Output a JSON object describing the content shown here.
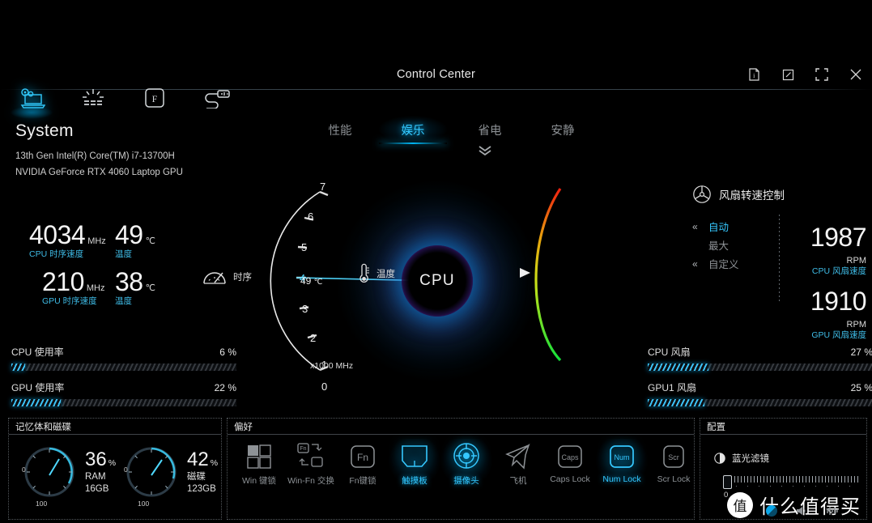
{
  "window": {
    "title": "Control Center",
    "buttons": [
      {
        "name": "info-button",
        "icon": "info-icon"
      },
      {
        "name": "shrink-button",
        "icon": "shrink-icon"
      },
      {
        "name": "maximize-button",
        "icon": "maximize-icon"
      },
      {
        "name": "close-button",
        "icon": "close-icon"
      }
    ]
  },
  "topnav": {
    "items": [
      {
        "label": "system",
        "icon": "system-gears-laptop-icon",
        "active": true
      },
      {
        "label": "lighting",
        "icon": "keyboard-backlight-icon",
        "active": false
      },
      {
        "label": "fn-key",
        "icon": "f-key-icon",
        "active": false
      },
      {
        "label": "devices",
        "icon": "usb-device-icon",
        "active": false
      }
    ]
  },
  "system": {
    "heading": "System",
    "cpu_name": "13th Gen Intel(R) Core(TM) i7-13700H",
    "gpu_name": "NVIDIA GeForce RTX 4060 Laptop GPU"
  },
  "tabs": [
    {
      "label": "性能",
      "active": false
    },
    {
      "label": "娱乐",
      "active": true
    },
    {
      "label": "省电",
      "active": false
    },
    {
      "label": "安静",
      "active": false
    }
  ],
  "readouts": {
    "cpu_clock": {
      "value": "4034",
      "unit": "MHz",
      "label": "CPU 时序速度"
    },
    "cpu_temp": {
      "value": "49",
      "unit": "℃",
      "label": "温度"
    },
    "gpu_clock": {
      "value": "210",
      "unit": "MHz",
      "label": "GPU 时序速度"
    },
    "gpu_temp": {
      "value": "38",
      "unit": "℃",
      "label": "温度"
    },
    "timing_label": "时序"
  },
  "usage": {
    "cpu": {
      "label": "CPU 使用率",
      "value": "6",
      "unit": "%",
      "percent": 6
    },
    "gpu": {
      "label": "GPU 使用率",
      "value": "22",
      "unit": "%",
      "percent": 22
    },
    "cpu_fan": {
      "label": "CPU 风扇",
      "value": "27",
      "unit": "%",
      "percent": 27
    },
    "gpu_fan": {
      "label": "GPU1 风扇",
      "value": "25",
      "unit": "%",
      "percent": 25
    }
  },
  "dial": {
    "scale_ticks": [
      "7",
      "6",
      "5",
      "4",
      "3",
      "2",
      "1",
      "0"
    ],
    "scale_unit": "x1000 MHz",
    "center_label": "CPU",
    "needle_value": "4.0",
    "temp_value": "49",
    "temp_unit": "℃",
    "temp_label": "温度"
  },
  "fan": {
    "heading": "风扇转速控制",
    "modes": [
      {
        "label": "自动",
        "active": true,
        "arrow": true
      },
      {
        "label": "最大",
        "active": false,
        "arrow": false
      },
      {
        "label": "自定义",
        "active": false,
        "arrow": true
      }
    ],
    "cpu_fan": {
      "value": "1987",
      "unit": "RPM",
      "label": "CPU 风扇速度"
    },
    "gpu_fan": {
      "value": "1910",
      "unit": "RPM",
      "label": "GPU 风扇速度"
    }
  },
  "memory_panel": {
    "title": "记忆体和磁碟",
    "gauges": [
      {
        "name": "ram",
        "value": "36",
        "unit": "%",
        "label": "RAM",
        "capacity": "16GB",
        "min": "0",
        "max": "100",
        "percent": 36
      },
      {
        "name": "disk",
        "value": "42",
        "unit": "%",
        "label": "磁碟",
        "capacity": "123GB",
        "min": "0",
        "max": "100",
        "percent": 42
      }
    ]
  },
  "pref_panel": {
    "title": "偏好",
    "items": [
      {
        "label": "Win 键锁",
        "icon": "win-key-lock-icon",
        "active": false
      },
      {
        "label": "Win-Fn 交换",
        "icon": "win-fn-swap-icon",
        "active": false
      },
      {
        "label": "Fn键锁",
        "icon": "fn-key-lock-icon",
        "active": false
      },
      {
        "label": "触摸板",
        "icon": "touchpad-icon",
        "active": true
      },
      {
        "label": "摄像头",
        "icon": "camera-icon",
        "active": true
      },
      {
        "label": "飞机",
        "icon": "airplane-mode-icon",
        "active": false
      },
      {
        "label": "Caps Lock",
        "icon": "caps-lock-icon",
        "active": false
      },
      {
        "label": "Num Lock",
        "icon": "num-lock-icon",
        "active": true
      },
      {
        "label": "Scr Lock",
        "icon": "scroll-lock-icon",
        "active": false
      }
    ]
  },
  "config_panel": {
    "title": "配置",
    "bluelight": {
      "label": "蓝光滤镜",
      "icon": "moon-icon",
      "value": "0"
    }
  },
  "watermark": {
    "badge": "值",
    "text": "什么值得买"
  },
  "colors": {
    "accent": "#35c8ff",
    "label": "#3fbde8",
    "muted": "#8d9296",
    "bg": "#000000"
  }
}
